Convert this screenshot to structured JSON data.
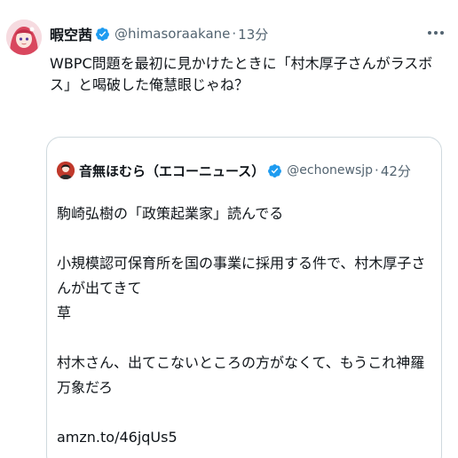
{
  "tweet": {
    "display_name": "暇空茜",
    "handle": "@himasoraakane",
    "separator": "·",
    "time": "13分",
    "text": "WBPC問題を最初に見かけたときに「村木厚子さんがラスボス」と喝破した俺慧眼じゃね？",
    "icons": [
      "avatar",
      "verified-icon",
      "more-icon"
    ]
  },
  "quote": {
    "display_name": "音無ほむら（エコーニュース）",
    "handle": "@echonewsjp",
    "separator": "·",
    "time": "42分",
    "lines": [
      "駒崎弘樹の「政策起業家」読んでる",
      "",
      "小規模認可保育所を国の事業に採用する件で、村木厚子さんが出てきて",
      "草",
      "",
      "村木さん、出てこないところの方がなくて、もうこれ神羅万象だろ",
      "",
      "amzn.to/46jqUs5"
    ]
  },
  "colors": {
    "primary_text": "#0f1419",
    "secondary_text": "#536471",
    "verified": "#1d9bf0",
    "border": "#cfd9de"
  }
}
